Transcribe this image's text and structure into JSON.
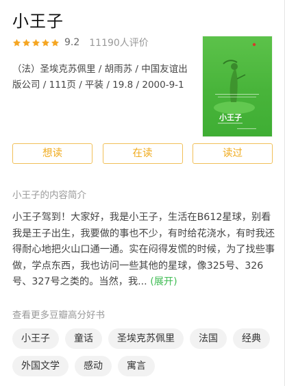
{
  "book": {
    "title": "小王子",
    "rating": {
      "stars": 5,
      "score": "9.2",
      "count_text": "11190人评价"
    },
    "meta": "（法）圣埃克苏佩里 / 胡雨苏 / 中国友谊出版公司 / 111页 / 平装 / 19.8 / 2000-9-1",
    "cover": {
      "title_text": "小王子",
      "background_color": "#4cb63f"
    }
  },
  "actions": {
    "want_label": "想读",
    "reading_label": "在读",
    "read_label": "读过"
  },
  "intro": {
    "heading": "小王子的内容简介",
    "text": "小王子驾到！大家好，我是小王子，生活在B612星球，别看我是王子出生，我要做的事也不少，有时给花浇水，有时我还得耐心地把火山口通一通。实在闷得发慌的时候，为了找些事做，学点东西，我也访问一些其他的星球，像325号、326号、327号之类的。当然，我...",
    "expand_label": "(展开)"
  },
  "more": {
    "heading": "查看更多豆瓣高分好书",
    "tags": [
      "小王子",
      "童话",
      "圣埃克苏佩里",
      "法国",
      "经典",
      "外国文学",
      "感动",
      "寓言"
    ]
  },
  "colors": {
    "accent": "#f0ab1e",
    "star": "#f5a623",
    "link": "#42bd56"
  }
}
